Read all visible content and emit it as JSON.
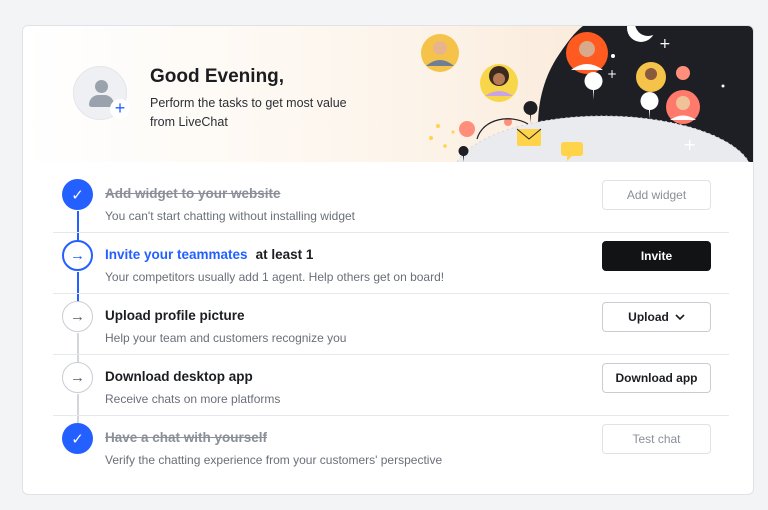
{
  "header": {
    "title": "Good Evening,",
    "subtitle": "Perform the tasks to get most value from LiveChat"
  },
  "colors": {
    "accent": "#2360ff",
    "primary_button": "#111315",
    "done_text": "#8a8f98",
    "illustration_dark": "#1e1f24"
  },
  "tasks": [
    {
      "status": "done",
      "icon": "check-icon",
      "title": "Add widget to your website",
      "suffix": "",
      "description": "You can't start chatting without installing widget",
      "button": "Add widget",
      "button_style": "disabled"
    },
    {
      "status": "current",
      "icon": "arrow-right-icon",
      "title": "Invite your teammates",
      "suffix": "at least 1",
      "description": "Your competitors usually add 1 agent. Help others get on board!",
      "button": "Invite",
      "button_style": "primary"
    },
    {
      "status": "todo",
      "icon": "arrow-right-icon",
      "title": "Upload profile picture",
      "suffix": "",
      "description": "Help your team and customers recognize you",
      "button": "Upload",
      "button_style": "outline",
      "button_icon": "chevron-down-icon"
    },
    {
      "status": "todo",
      "icon": "arrow-right-icon",
      "title": "Download desktop app",
      "suffix": "",
      "description": "Receive chats on more platforms",
      "button": "Download app",
      "button_style": "outline"
    },
    {
      "status": "done",
      "icon": "check-icon",
      "title": "Have a chat with yourself",
      "suffix": "",
      "description": "Verify the chatting experience from your customers' perspective",
      "button": "Test chat",
      "button_style": "disabled"
    }
  ]
}
